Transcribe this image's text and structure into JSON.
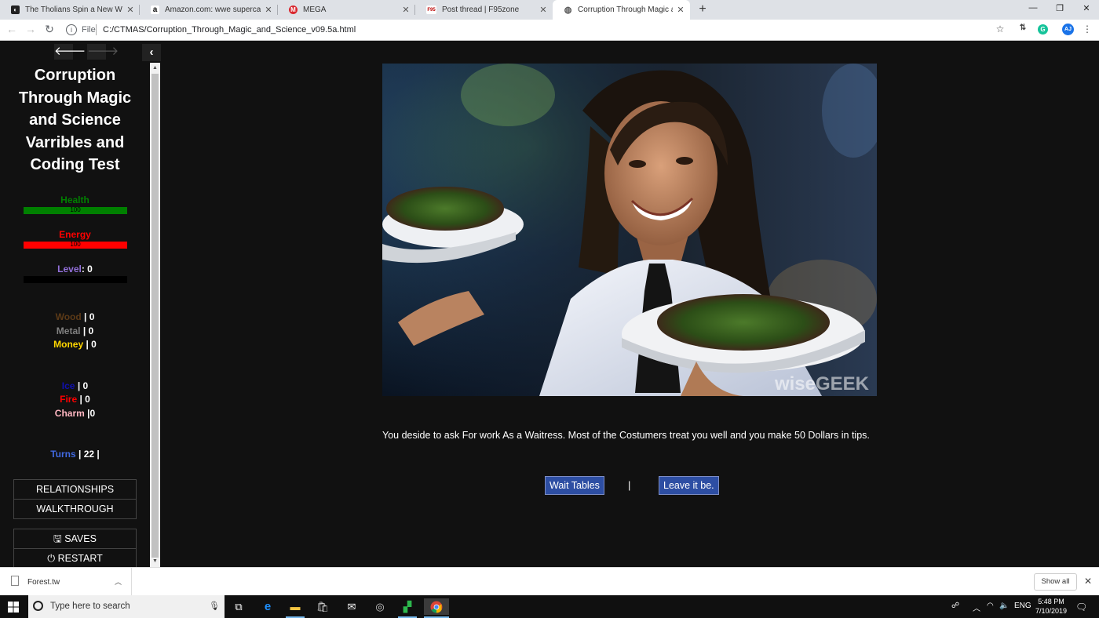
{
  "browser": {
    "tabs": [
      {
        "title": "The Tholians Spin a New Web | S",
        "icon": "tholians-favicon-icon"
      },
      {
        "title": "Amazon.com: wwe supercard",
        "icon": "amazon-favicon-icon"
      },
      {
        "title": "MEGA",
        "icon": "mega-favicon-icon"
      },
      {
        "title": "Post thread | F95zone",
        "icon": "f95-favicon-icon"
      },
      {
        "title": "Corruption Through Magic and S",
        "icon": "globe-favicon-icon",
        "active": true
      }
    ],
    "favicon_letters": {
      "amazon": "a",
      "mega": "M",
      "f95": "F95"
    },
    "address": {
      "scheme_label": "File",
      "url": "C:/CTMAS/Corruption_Through_Magic_and_Science_v09.5a.html"
    },
    "extensions": {
      "avatar": "AJ",
      "grammarly": "G"
    }
  },
  "sidebar": {
    "back_icon": "arrow-left-icon",
    "forward_icon": "arrow-right-icon",
    "collapse_icon": "chevron-left-icon",
    "title": "Corruption Through Magic and Science Varribles and Coding Test",
    "health": {
      "label": "Health",
      "value": "100",
      "fraction": 1.0,
      "color": "#008000"
    },
    "energy": {
      "label": "Energy",
      "value": "100",
      "fraction": 1.0,
      "color": "#ff0000"
    },
    "level": {
      "label": "Level",
      "value": "0",
      "fraction": 0.0,
      "color": "#9370db"
    },
    "resources": [
      {
        "label": "Wood",
        "value": "| 0",
        "color": "#5c3a17"
      },
      {
        "label": "Metal",
        "value": "| 0",
        "color": "#808080"
      },
      {
        "label": "Money",
        "value": "| 0",
        "color": "#ffd700"
      }
    ],
    "magic": [
      {
        "label": "Ice",
        "value": "| 0",
        "color": "#1010b0"
      },
      {
        "label": "Fire",
        "value": "| 0",
        "color": "#ff0000"
      },
      {
        "label": "Charm",
        "value": "|0",
        "color": "#ffb6c1"
      }
    ],
    "turns": {
      "label": "Turns",
      "value": "| 22 |",
      "color": "#4169e1"
    },
    "menu": {
      "relationships": "RELATIONSHIPS",
      "walkthrough": "WALKTHROUGH",
      "saves": "SAVES",
      "restart": "RESTART"
    }
  },
  "story": {
    "image_watermark": "wiseGEEK",
    "passage": "You deside to ask For work As a Waitress. Most of the Costumers treat you well and you make 50 Dollars in tips.",
    "choices": [
      {
        "label": "Wait Tables"
      },
      {
        "label": "Leave it be."
      }
    ],
    "choice_separator": "|"
  },
  "downloads": {
    "file": "Forest.tw",
    "show_all": "Show all"
  },
  "taskbar": {
    "search_placeholder": "Type here to search",
    "language": "ENG",
    "time": "5:48 PM",
    "date": "7/10/2019"
  }
}
